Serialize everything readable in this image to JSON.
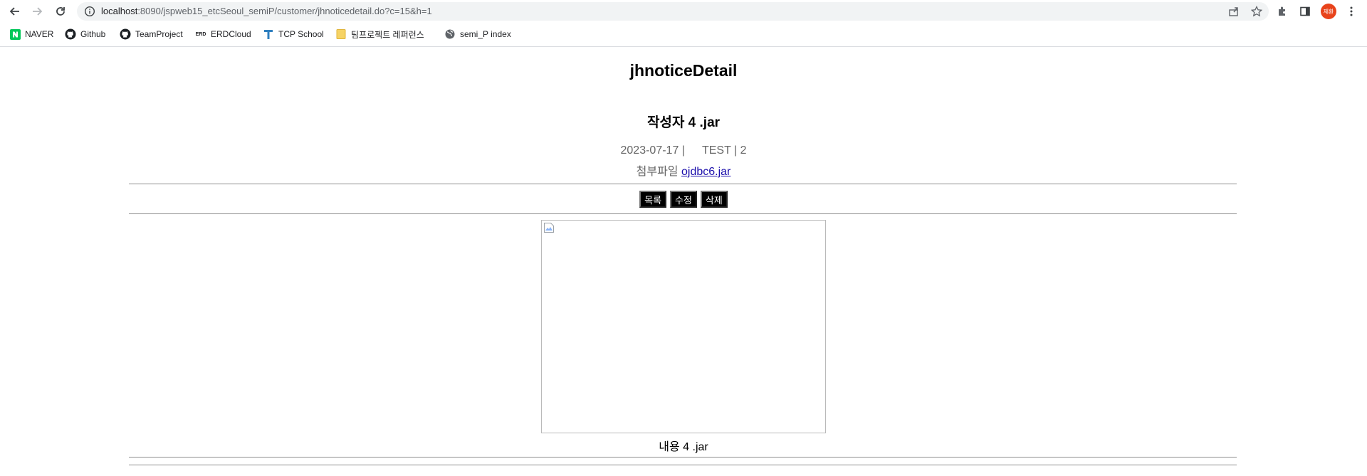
{
  "browser": {
    "url_host": "localhost",
    "url_path": ":8090/jspweb15_etcSeoul_semiP/customer/jhnoticedetail.do?c=15&h=1",
    "avatar_text": "재환",
    "bookmarks": [
      {
        "label": "NAVER",
        "icon": "naver-icon"
      },
      {
        "label": "Github",
        "icon": "github-icon"
      },
      {
        "label": "TeamProject",
        "icon": "github-icon"
      },
      {
        "label": "ERDCloud",
        "icon": "erd-icon"
      },
      {
        "label": "TCP School",
        "icon": "tcp-icon"
      },
      {
        "label": "팀프로젝트 레퍼런스",
        "icon": "folder-icon"
      },
      {
        "label": "semi_P index",
        "icon": "globe-icon"
      }
    ]
  },
  "page": {
    "title": "jhnoticeDetail",
    "subject": "작성자 4 .jar",
    "date": "2023-07-17 |",
    "writer_hit": "TEST | 2",
    "attach_label": "첨부파일",
    "attach_file": "ojdbc6.jar",
    "buttons": {
      "list": "목록",
      "edit": "수정",
      "delete": "삭제"
    },
    "content": "내용 4 .jar"
  }
}
